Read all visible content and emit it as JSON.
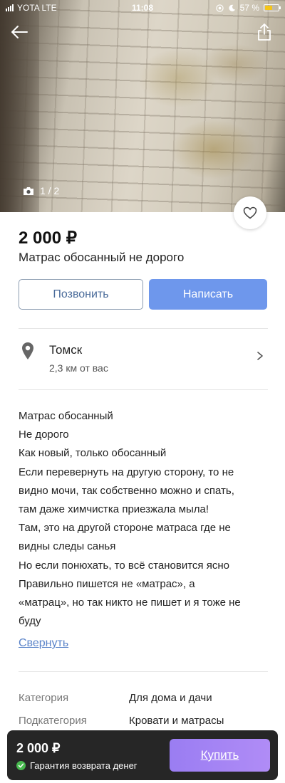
{
  "status_bar": {
    "carrier": "YOTA LTE",
    "time": "11:08",
    "battery": "57 %",
    "battery_level": 0.57
  },
  "gallery": {
    "counter": "1 / 2"
  },
  "listing": {
    "price": "2 000 ₽",
    "title": "Матрас обосанный не дорого"
  },
  "actions": {
    "call_label": "Позвонить",
    "write_label": "Написать"
  },
  "location": {
    "city": "Томск",
    "distance": "2,3 км от вас"
  },
  "description": {
    "lines": [
      "Матрас обосанный",
      "Не дорого",
      "Как новый, только обосанный",
      "Если перевернуть на другую сторону, то не",
      "видно мочи, так собственно можно и спать,",
      "там даже химчистка приезжала мыла!",
      "Там, это на другой стороне матраса где не",
      "видны следы санья",
      "Но если понюхать, то всё становится ясно",
      "Правильно пишется не «матрас», а",
      "«матрац», но так никто не пишет и я тоже не",
      "буду"
    ],
    "collapse_label": "Свернуть"
  },
  "attributes": [
    {
      "label": "Категория",
      "value": "Для дома и дачи"
    },
    {
      "label": "Подкатегория",
      "value": "Кровати и матрасы"
    }
  ],
  "bottom_bar": {
    "price": "2 000 ₽",
    "guarantee": "Гарантия возврата денег",
    "buy_label": "Купить"
  },
  "colors": {
    "primary_button": "#6e97ec",
    "buy_button": "#a585f4",
    "link": "#5b84c9",
    "bottom_bar": "#262626",
    "guarantee_check": "#47b84e"
  }
}
